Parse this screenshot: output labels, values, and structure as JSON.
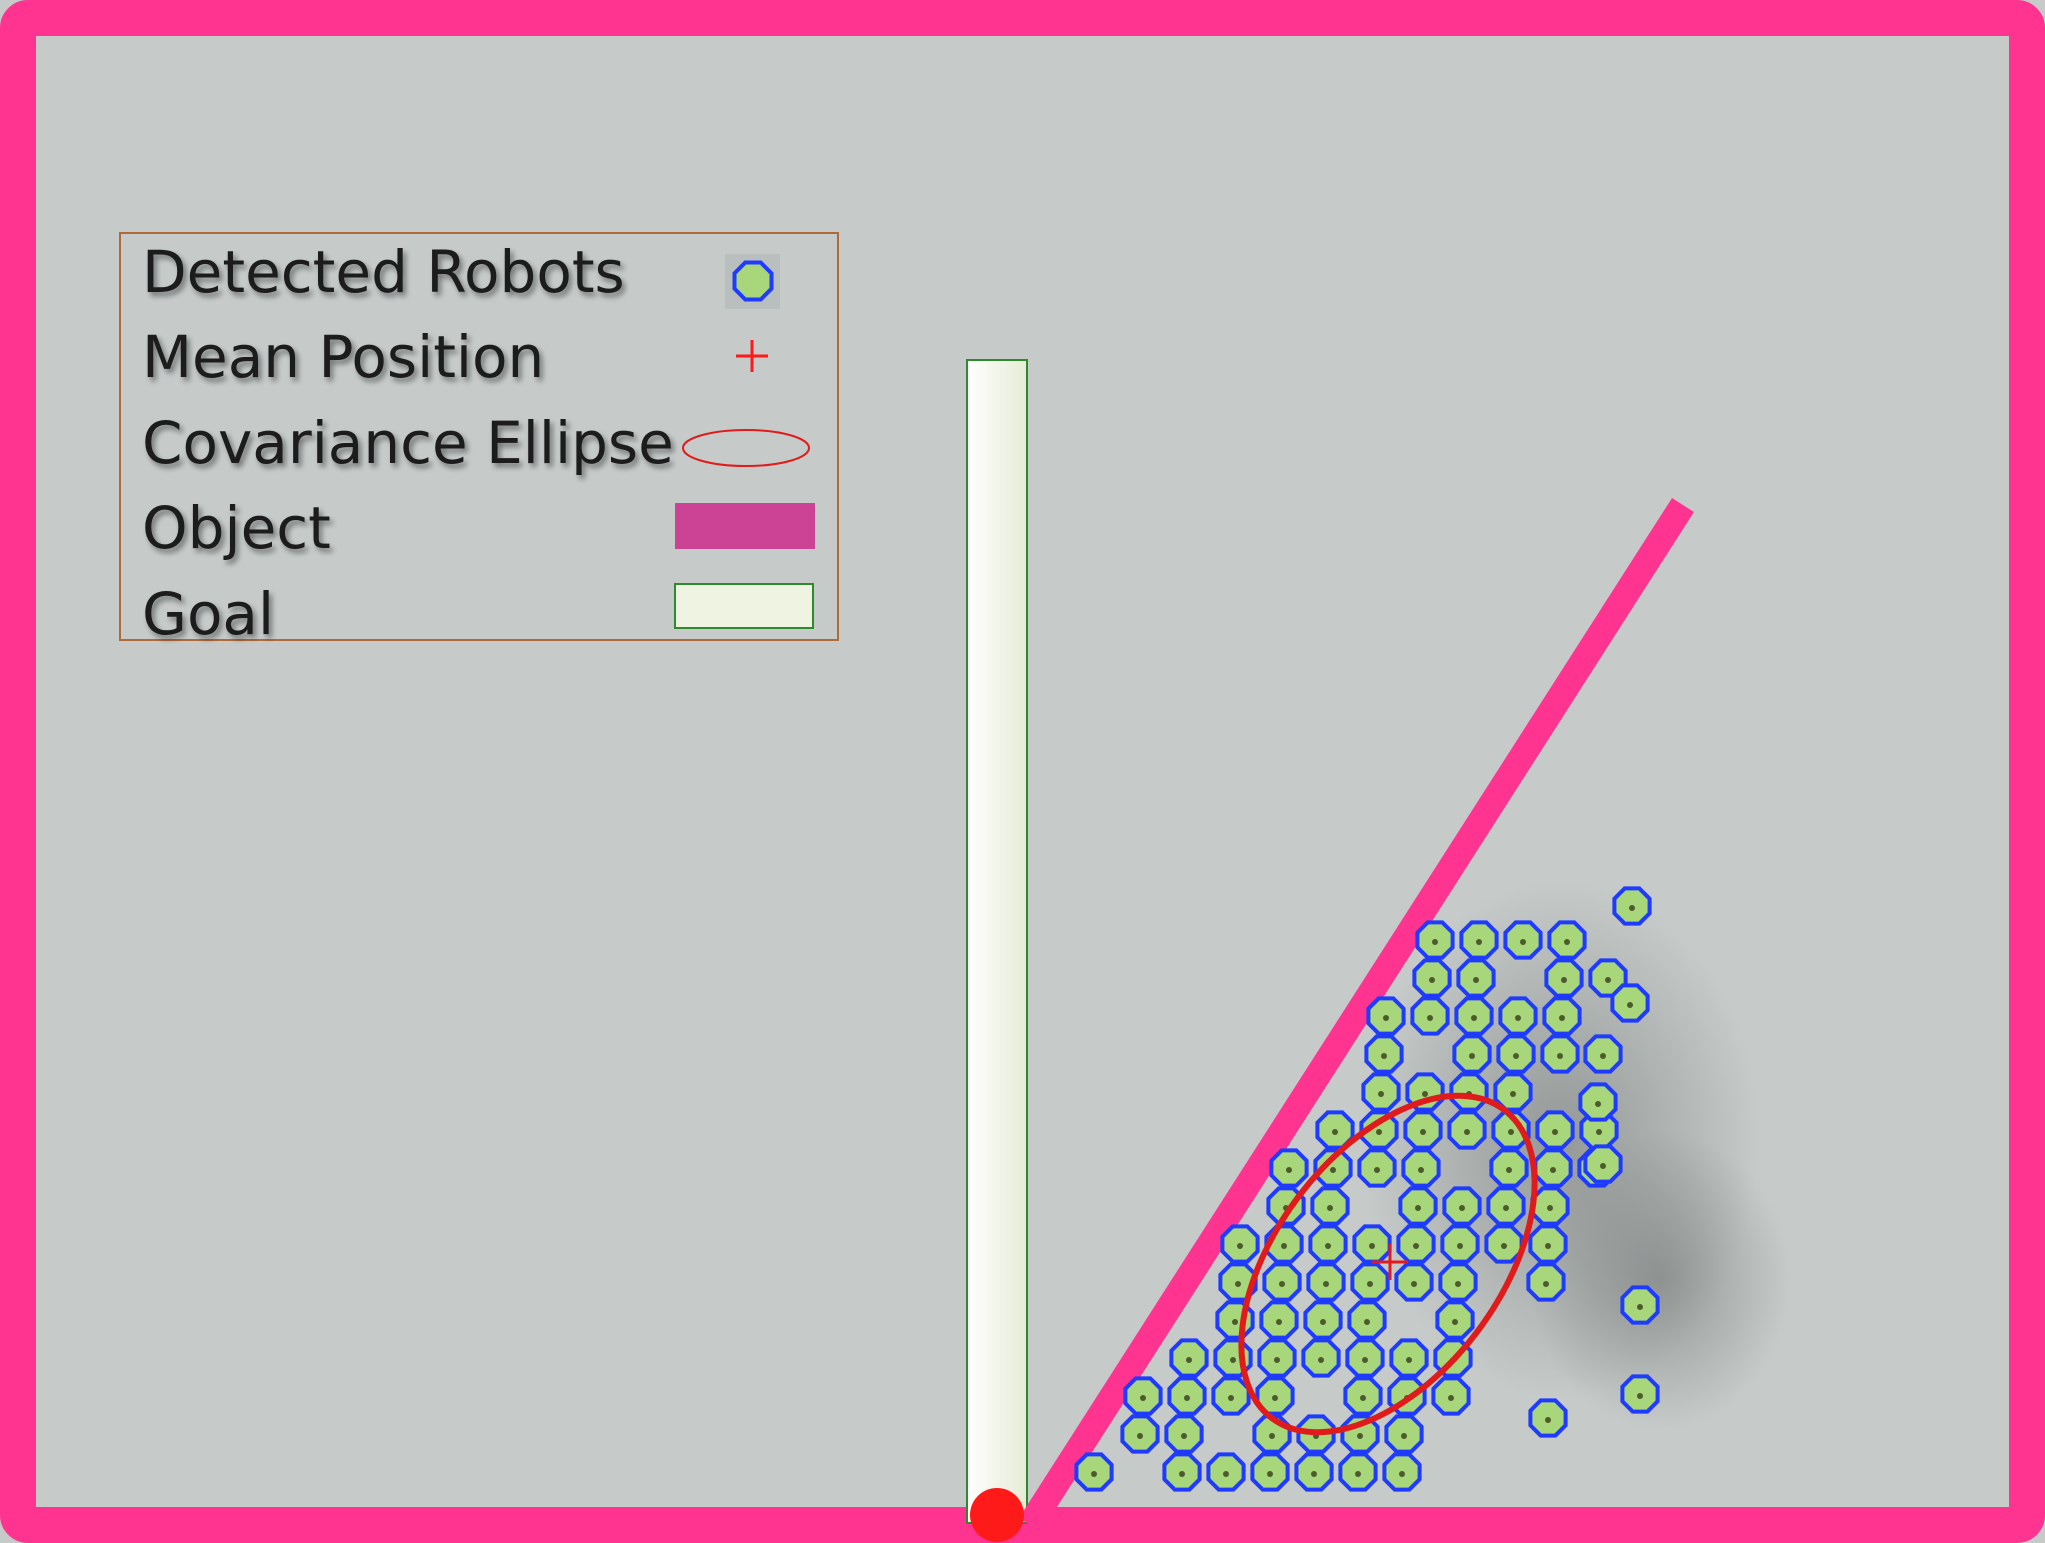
{
  "legend": {
    "items": [
      {
        "label": "Detected Robots"
      },
      {
        "label": "Mean Position"
      },
      {
        "label": "Covariance Ellipse"
      },
      {
        "label": "Object"
      },
      {
        "label": "Goal"
      }
    ]
  },
  "colors": {
    "background": "#c6cbca",
    "arena_border": "#ff3390",
    "object": "#ff3390",
    "object_legend": "#cc4295",
    "goal_fill": "#eef3e2",
    "goal_border": "#2d8b2d",
    "robot_ring": "#1f3bff",
    "robot_body": "#a7d77a",
    "mean_marker": "#ff1a1a",
    "ellipse": "#e01b1b",
    "legend_border": "#b06a3a",
    "pivot": "#ff1a1a"
  },
  "icons": {
    "robot": "robot-marker-icon",
    "mean": "plus-marker-icon",
    "ellipse": "ellipse-icon",
    "object": "object-swatch-icon",
    "goal": "goal-swatch-icon"
  }
}
